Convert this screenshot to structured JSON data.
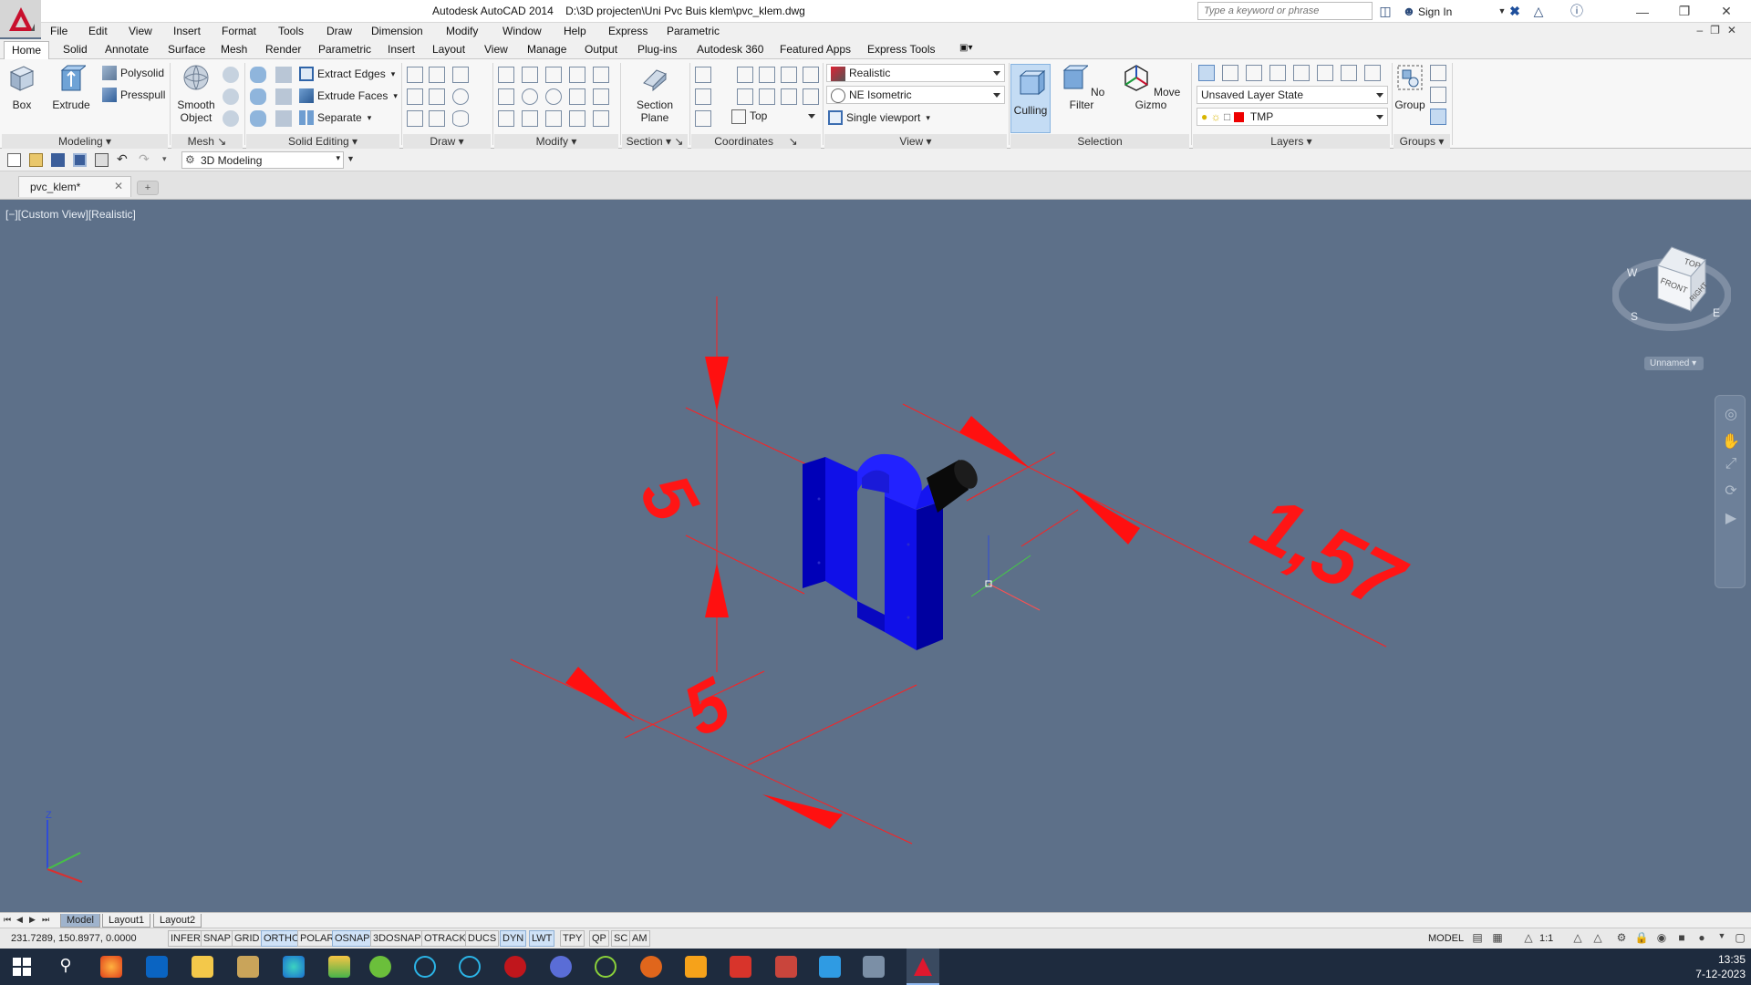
{
  "title_bar": {
    "app_title": "Autodesk AutoCAD 2014    D:\\3D projecten\\Uni Pvc Buis klem\\pvc_klem.dwg",
    "search_placeholder": "Type a keyword or phrase",
    "sign_in": "Sign In"
  },
  "menu": [
    "File",
    "Edit",
    "View",
    "Insert",
    "Format",
    "Tools",
    "Draw",
    "Dimension",
    "Modify",
    "Window",
    "Help",
    "Express",
    "Parametric"
  ],
  "ribbon_tabs": [
    "Home",
    "Solid",
    "Annotate",
    "Surface",
    "Mesh",
    "Render",
    "Parametric",
    "Insert",
    "Layout",
    "View",
    "Manage",
    "Output",
    "Plug-ins",
    "Autodesk 360",
    "Featured Apps",
    "Express Tools"
  ],
  "ribbon": {
    "modeling": {
      "box": "Box",
      "extrude": "Extrude",
      "polysolid": "Polysolid",
      "presspull": "Presspull",
      "panel": "Modeling"
    },
    "mesh": {
      "smooth_object_1": "Smooth",
      "smooth_object_2": "Object",
      "panel": "Mesh"
    },
    "solid_editing": {
      "extract_edges": "Extract Edges",
      "extrude_faces": "Extrude Faces",
      "separate": "Separate",
      "panel": "Solid Editing"
    },
    "draw": {
      "panel": "Draw"
    },
    "modify": {
      "panel": "Modify"
    },
    "section": {
      "section_plane_1": "Section",
      "section_plane_2": "Plane",
      "panel": "Section"
    },
    "coordinates": {
      "panel": "Coordinates"
    },
    "view": {
      "visual_style": "Realistic",
      "view_dir": "NE Isometric",
      "ucs": "Top",
      "viewport": "Single viewport",
      "panel": "View"
    },
    "selection": {
      "culling": "Culling",
      "no_filter": "No Filter",
      "move_gizmo": "Move Gizmo",
      "panel": "Selection"
    },
    "layers": {
      "layer_state": "Unsaved Layer State",
      "layer": "TMP",
      "panel": "Layers"
    },
    "groups": {
      "group": "Group",
      "panel": "Groups"
    }
  },
  "quick_access": {
    "workspace": "3D Modeling"
  },
  "file_tab": {
    "name": "pvc_klem*"
  },
  "viewport": {
    "label": "[−][Custom View][Realistic]",
    "dimensions": {
      "height": "5",
      "width": "5",
      "radius": "1,57"
    },
    "viewcube": {
      "top": "TOP",
      "front": "FRONT",
      "right": "RIGHT",
      "w": "W",
      "s": "S",
      "e": "E",
      "view_name": "Unnamed"
    },
    "colors": {
      "background": "#5d7089",
      "part": "#1010c8",
      "pin": "#111111",
      "dimension": "#ff0000"
    }
  },
  "layout_tabs": [
    "Model",
    "Layout1",
    "Layout2"
  ],
  "status_bar": {
    "coords": "231.7289, 150.8977, 0.0000",
    "toggles": [
      {
        "label": "INFER",
        "on": false
      },
      {
        "label": "SNAP",
        "on": false
      },
      {
        "label": "GRID",
        "on": false
      },
      {
        "label": "ORTHO",
        "on": true
      },
      {
        "label": "POLAR",
        "on": false
      },
      {
        "label": "OSNAP",
        "on": true
      },
      {
        "label": "3DOSNAP",
        "on": false
      },
      {
        "label": "OTRACK",
        "on": false
      },
      {
        "label": "DUCS",
        "on": false
      },
      {
        "label": "DYN",
        "on": true
      },
      {
        "label": "LWT",
        "on": true
      },
      {
        "label": "TPY",
        "on": false
      },
      {
        "label": "QP",
        "on": false
      },
      {
        "label": "SC",
        "on": false
      },
      {
        "label": "AM",
        "on": false
      }
    ],
    "model": "MODEL",
    "scale": "1:1"
  },
  "taskbar": {
    "time": "13:35",
    "date": "7-12-2023"
  }
}
